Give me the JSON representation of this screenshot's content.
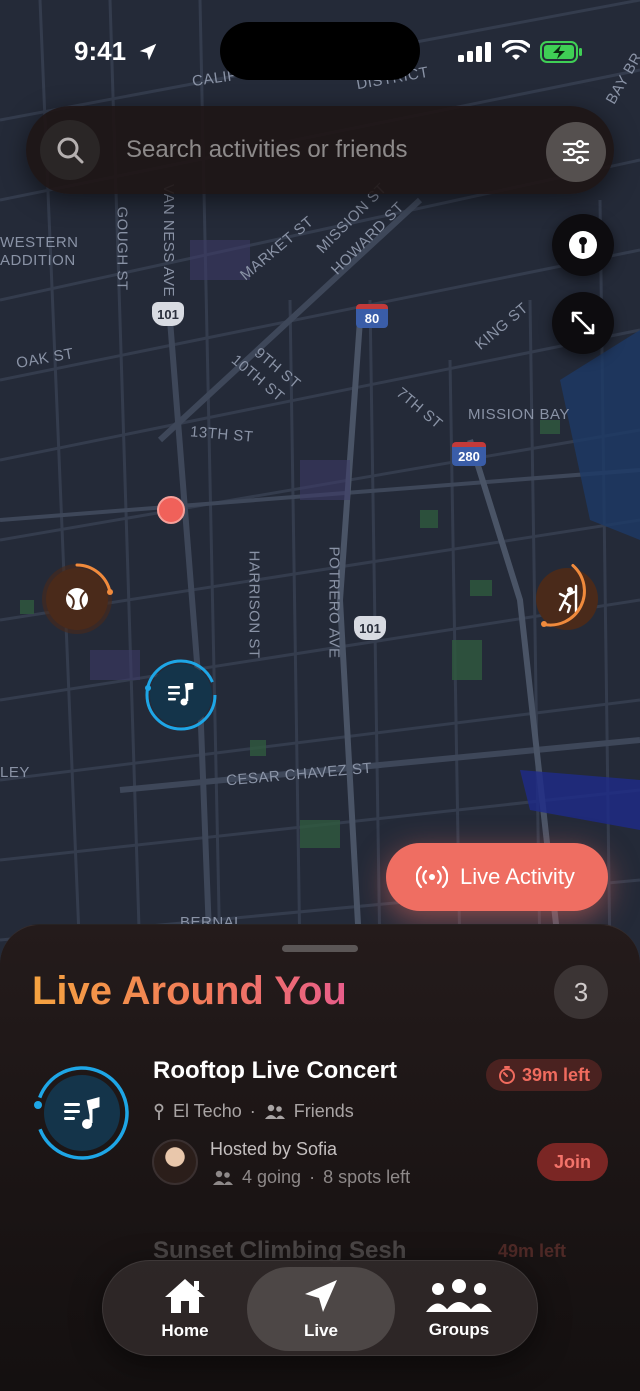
{
  "status_bar": {
    "time": "9:41"
  },
  "search": {
    "placeholder": "Search activities or friends"
  },
  "map": {
    "labels": {
      "western_addition": "WESTERN\nADDITION",
      "oak_st": "OAK ST",
      "gough_st": "GOUGH ST",
      "van_ness": "VAN NESS AVE",
      "market_st": "MARKET ST",
      "mission_st": "MISSION ST",
      "howard_st": "HOWARD ST",
      "ninth_st": "9TH ST",
      "tenth_st": "10TH ST",
      "thirteenth_st": "13TH ST",
      "seventh_st": "7TH ST",
      "king_st": "KING ST",
      "mission_bay": "MISSION BAY",
      "harrison_st": "HARRISON ST",
      "potrero_ave": "POTRERO AVE",
      "cesar_chavez": "CESAR CHAVEZ ST",
      "ley": "LEY",
      "bernal": "BERNAL",
      "calif": "CALIF",
      "district": "DISTRICT",
      "bay_br": "BAY BR"
    },
    "shields": {
      "us101_a": "101",
      "i80": "80",
      "i280": "280",
      "us101_b": "101"
    },
    "pins": [
      "tennis-ball-icon",
      "music-note-icon",
      "climbing-icon"
    ]
  },
  "live_button": {
    "label": "Live Activity"
  },
  "sheet": {
    "title": "Live Around You",
    "count": "3",
    "activities": [
      {
        "title": "Rooftop Live Concert",
        "time_left": "39m left",
        "location": "El Techo",
        "visibility": "Friends",
        "host": "Hosted by Sofia",
        "going": "4 going",
        "spots": "8 spots left",
        "action": "Join"
      },
      {
        "title": "Sunset Climbing Sesh",
        "time_left": "49m left"
      }
    ]
  },
  "tabs": [
    {
      "label": "Home",
      "icon": "house-icon"
    },
    {
      "label": "Live",
      "icon": "location-arrow-icon"
    },
    {
      "label": "Groups",
      "icon": "people-icon"
    }
  ],
  "colors": {
    "accent": "#ef6e62",
    "music_ring": "#1ea6e6",
    "sports_ring": "#f08a3c"
  }
}
